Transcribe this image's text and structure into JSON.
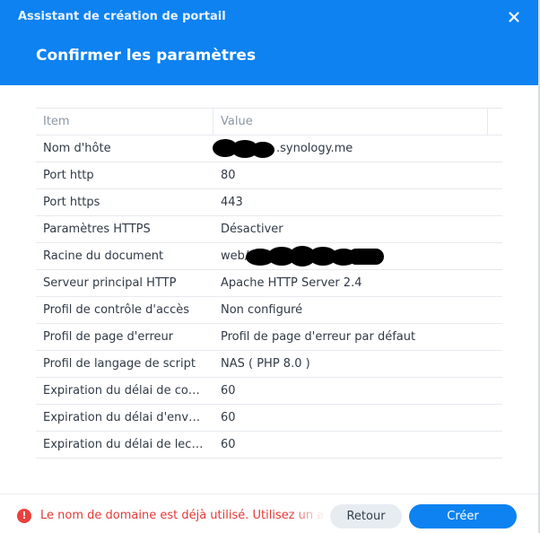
{
  "dialog": {
    "window_title": "Assistant de création de portail",
    "heading": "Confirmer les paramètres",
    "close_icon": "close-icon"
  },
  "table": {
    "headers": [
      "Item",
      "Value"
    ],
    "rows": [
      {
        "key": "Nom d'hôte",
        "value": ".synology.me"
      },
      {
        "key": "Port http",
        "value": "80"
      },
      {
        "key": "Port https",
        "value": "443"
      },
      {
        "key": "Paramètres HTTPS",
        "value": "Désactiver"
      },
      {
        "key": "Racine du document",
        "value": "web/"
      },
      {
        "key": "Serveur principal HTTP",
        "value": "Apache HTTP Server 2.4"
      },
      {
        "key": "Profil de contrôle d'accès",
        "value": "Non configuré"
      },
      {
        "key": "Profil de page d'erreur",
        "value": "Profil de page d'erreur par défaut"
      },
      {
        "key": "Profil de langage de script",
        "value": "NAS ( PHP 8.0 )"
      },
      {
        "key": "Expiration du délai de con...",
        "value": "60"
      },
      {
        "key": "Expiration du délai d'envo...",
        "value": "60"
      },
      {
        "key": "Expiration du délai de lect...",
        "value": "60"
      }
    ]
  },
  "footer": {
    "error_icon": "exclamation-circle-icon",
    "error_text": "Le nom de domaine est déjà utilisé. Utilisez un autre",
    "back_label": "Retour",
    "create_label": "Créer"
  },
  "colors": {
    "accent": "#0d82f0",
    "error": "#e23a36"
  }
}
